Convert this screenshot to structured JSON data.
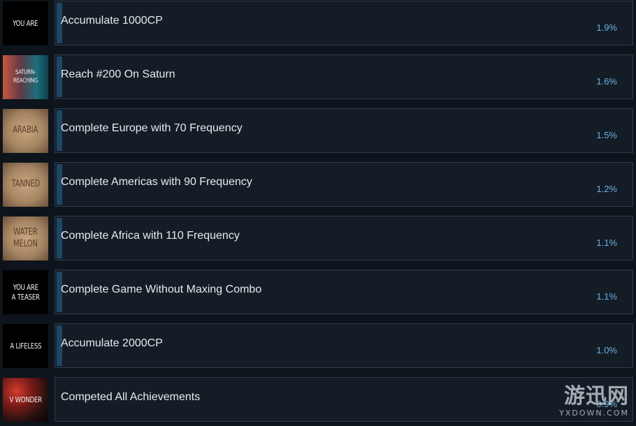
{
  "achievements": [
    {
      "title": "Accumulate 1000CP",
      "percent": "1.9%",
      "icon_text": "YOU ARE",
      "icon_style": "black",
      "icon_name": "you-are-icon"
    },
    {
      "title": "Reach #200 On Saturn",
      "percent": "1.6%",
      "icon_text": "SATURN-REACHING",
      "icon_style": "saturn",
      "icon_name": "saturn-reaching-icon"
    },
    {
      "title": "Complete Europe with 70 Frequency",
      "percent": "1.5%",
      "icon_text": "ARABIA",
      "icon_style": "sepia",
      "icon_name": "arabia-icon"
    },
    {
      "title": "Complete Americas with 90 Frequency",
      "percent": "1.2%",
      "icon_text": "TANNED",
      "icon_style": "sepia",
      "icon_name": "tanned-icon"
    },
    {
      "title": "Complete Africa with 110 Frequency",
      "percent": "1.1%",
      "icon_text": "WATER\nMELON",
      "icon_style": "sepia",
      "icon_name": "water-melon-icon"
    },
    {
      "title": "Complete Game Without Maxing Combo",
      "percent": "1.1%",
      "icon_text": "YOU ARE\nA TEASER",
      "icon_style": "black",
      "icon_name": "you-are-a-teaser-icon"
    },
    {
      "title": "Accumulate 2000CP",
      "percent": "1.0%",
      "icon_text": "A LIFELESS",
      "icon_style": "black",
      "icon_name": "a-lifeless-icon"
    },
    {
      "title": "Competed All Achievements",
      "percent": "0.9%",
      "icon_text": "V WONDER",
      "icon_style": "firework",
      "icon_name": "v-wonder-icon"
    }
  ],
  "watermark": {
    "main": "游迅网",
    "sub": "YXDOWN.COM"
  }
}
